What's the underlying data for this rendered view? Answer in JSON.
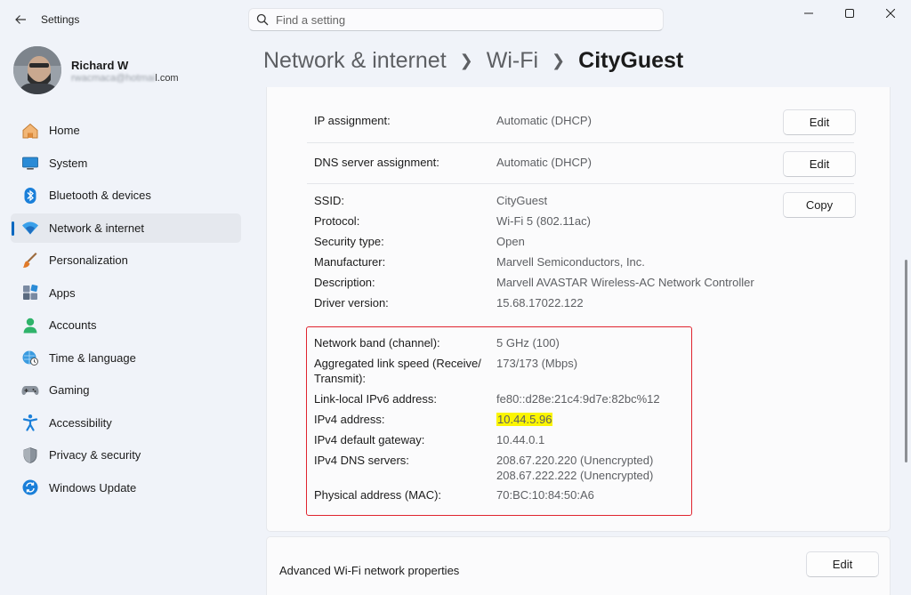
{
  "app": {
    "title": "Settings"
  },
  "search": {
    "placeholder": "Find a setting"
  },
  "profile": {
    "name": "Richard W",
    "email_visible_suffix": "l.com"
  },
  "nav": [
    {
      "label": "Home",
      "icon": "home-icon"
    },
    {
      "label": "System",
      "icon": "monitor-icon"
    },
    {
      "label": "Bluetooth & devices",
      "icon": "bluetooth-icon"
    },
    {
      "label": "Network & internet",
      "icon": "wifi-icon",
      "active": true
    },
    {
      "label": "Personalization",
      "icon": "brush-icon"
    },
    {
      "label": "Apps",
      "icon": "apps-icon"
    },
    {
      "label": "Accounts",
      "icon": "person-icon"
    },
    {
      "label": "Time & language",
      "icon": "globe-clock-icon"
    },
    {
      "label": "Gaming",
      "icon": "gamepad-icon"
    },
    {
      "label": "Accessibility",
      "icon": "accessibility-icon"
    },
    {
      "label": "Privacy & security",
      "icon": "shield-icon"
    },
    {
      "label": "Windows Update",
      "icon": "update-icon"
    }
  ],
  "breadcrumb": {
    "level1": "Network & internet",
    "level2": "Wi-Fi",
    "current": "CityGuest"
  },
  "settings": {
    "ip_assignment": {
      "label": "IP assignment:",
      "value": "Automatic (DHCP)",
      "button": "Edit"
    },
    "dns_assignment": {
      "label": "DNS server assignment:",
      "value": "Automatic (DHCP)",
      "button": "Edit"
    },
    "copy_button": "Copy",
    "details": [
      {
        "label": "SSID:",
        "value": "CityGuest"
      },
      {
        "label": "Protocol:",
        "value": "Wi-Fi 5 (802.11ac)"
      },
      {
        "label": "Security type:",
        "value": "Open"
      },
      {
        "label": "Manufacturer:",
        "value": "Marvell Semiconductors, Inc."
      },
      {
        "label": "Description:",
        "value": "Marvell AVASTAR Wireless-AC Network Controller"
      },
      {
        "label": "Driver version:",
        "value": "15.68.17022.122"
      }
    ],
    "network": {
      "band": {
        "label": "Network band (channel):",
        "value": "5 GHz (100)"
      },
      "link_speed": {
        "label_line1": "Aggregated link speed (Receive/",
        "label_line2": "Transmit):",
        "value": "173/173 (Mbps)"
      },
      "ipv6": {
        "label": "Link-local IPv6 address:",
        "value": "fe80::d28e:21c4:9d7e:82bc%12"
      },
      "ipv4": {
        "label": "IPv4 address:",
        "value": "10.44.5.96"
      },
      "gateway": {
        "label": "IPv4 default gateway:",
        "value": "10.44.0.1"
      },
      "dns": {
        "label": "IPv4 DNS servers:",
        "value1": "208.67.220.220 (Unencrypted)",
        "value2": "208.67.222.222 (Unencrypted)"
      },
      "mac": {
        "label": "Physical address (MAC):",
        "value": "70:BC:10:84:50:A6"
      }
    }
  },
  "advanced": {
    "label": "Advanced Wi-Fi network properties",
    "button": "Edit"
  },
  "colors": {
    "accent": "#0067c0",
    "highlight": "#fbf500",
    "annotation_box": "#e0242f"
  }
}
